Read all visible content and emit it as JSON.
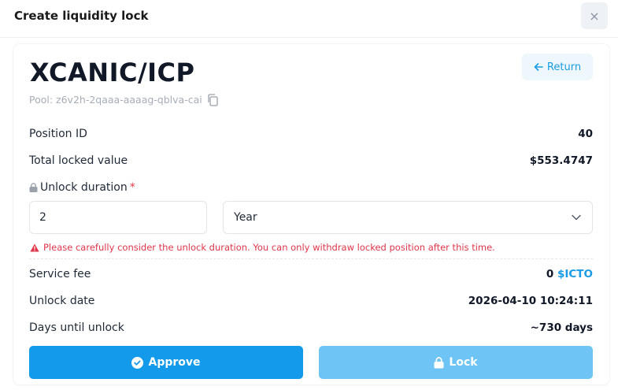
{
  "modal": {
    "title": "Create liquidity lock",
    "close_label": "×"
  },
  "pair": {
    "title": "XCANIC/ICP",
    "return_label": "Return",
    "pool_text": "Pool: z6v2h-2qaaa-aaaag-qblva-cai"
  },
  "rows": {
    "position_id_label": "Position ID",
    "position_id_value": "40",
    "total_locked_label": "Total locked value",
    "total_locked_value": "$553.4747"
  },
  "unlock": {
    "label": "Unlock duration",
    "required_mark": "*",
    "duration_value": "2",
    "unit_selected": "Year",
    "warning": "Please carefully consider the unlock duration. You can only withdraw locked position after this time."
  },
  "summary": {
    "service_fee_label": "Service fee",
    "service_fee_amount": "0",
    "service_fee_token": "$ICTO",
    "unlock_date_label": "Unlock date",
    "unlock_date_value": "2026-04-10 10:24:11",
    "days_label": "Days until unlock",
    "days_value": "~730 days"
  },
  "actions": {
    "approve_label": "Approve",
    "lock_label": "Lock"
  },
  "colors": {
    "accent": "#1a9be6",
    "approve_bg": "#149aea",
    "lock_bg": "#6ec4f5",
    "warning": "#e0354a"
  },
  "icons": {
    "close": "close-icon",
    "return": "arrow-left-icon",
    "copy": "copy-icon",
    "lock_label": "lock-icon",
    "chevron": "chevron-down-icon",
    "warning": "warning-triangle-icon",
    "approve": "check-circle-icon",
    "lock_button": "lock-icon"
  }
}
